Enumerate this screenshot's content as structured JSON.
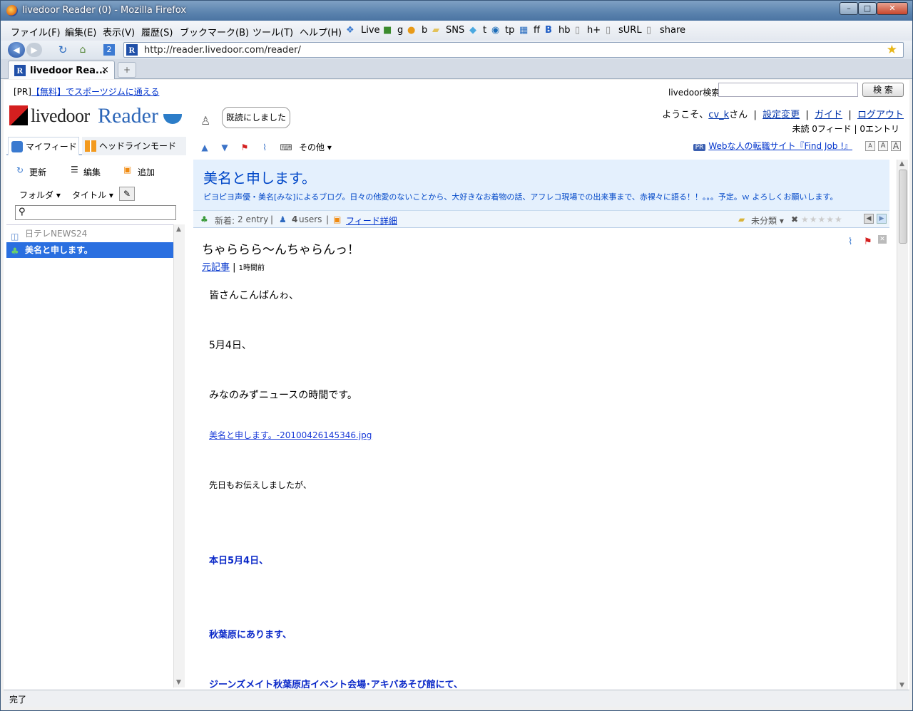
{
  "window": {
    "title": "livedoor Reader (0) - Mozilla Firefox"
  },
  "menu": [
    "ファイル(F)",
    "編集(E)",
    "表示(V)",
    "履歴(S)",
    "ブックマーク(B)",
    "ツール(T)",
    "ヘルプ(H)"
  ],
  "bookmarks": [
    "Live",
    "g",
    "b",
    "SNS",
    "t",
    "tp",
    "ff",
    "hb",
    "h+",
    "sURL",
    "share"
  ],
  "nav": {
    "url": "http://reader.livedoor.com/reader/"
  },
  "tab": {
    "title": "livedoor Rea...",
    "close": "×",
    "new": "+"
  },
  "page": {
    "pr_prefix": "[PR]",
    "pr_link": "【無料】でスポーツジムに通える",
    "search_label": "livedoor検索",
    "search_button": "検 索",
    "logo_text": "livedoor",
    "logo_reader": "Reader",
    "bubble": "既読にしました",
    "welcome": {
      "prefix": "ようこそ、",
      "user": "cv_k",
      "suffix": "さん",
      "settings": "設定変更",
      "guide": "ガイド",
      "logout": "ログアウト"
    },
    "counts": "未読 0フィード | 0エントリ",
    "side_tabs": {
      "myfeed": "マイフィード",
      "headline": "ヘッドラインモード"
    },
    "side_actions": {
      "refresh": "更新",
      "edit": "編集",
      "add": "追加",
      "folder": "フォルダ",
      "sort": "タイトル"
    },
    "subs": [
      {
        "label": "日テレNEWS24"
      },
      {
        "label": "美名と申します。"
      }
    ],
    "toolbar": {
      "other": "その他",
      "pr_badge": "PR",
      "pr_link": "Webな人の転職サイト『Find Job !』",
      "font_sizes": [
        "A",
        "A",
        "A"
      ]
    },
    "feed": {
      "title": "美名と申します。",
      "description": "ピヨピヨ声優・美名[みな]によるブログ。日々の他愛のないことから、大好きなお着物の話、アフレコ現場での出来事まで、赤裸々に語る！！。。。予定。ｗ よろしくお願いします。",
      "new_label": "新着:",
      "new_count": "2 entry",
      "users_count": "4",
      "users_label": "users",
      "detail": "フィード詳細",
      "category": "未分類"
    },
    "entry": {
      "title": "ちゃららら〜んちゃらんっ！",
      "source": "元記事",
      "time": "1時間前",
      "paragraphs": [
        "皆さんこんばんゎ、",
        "5月4日、",
        "みなのみずニュースの時間です。",
        "美名と申します。-20100426145346.jpg",
        "先日もお伝えしましたが、",
        "本日5月4日、",
        "秋葉原にあります、",
        "ジーンズメイト秋葉原店イベント会場･アキバあそび館にて、"
      ]
    }
  },
  "status": "完了"
}
